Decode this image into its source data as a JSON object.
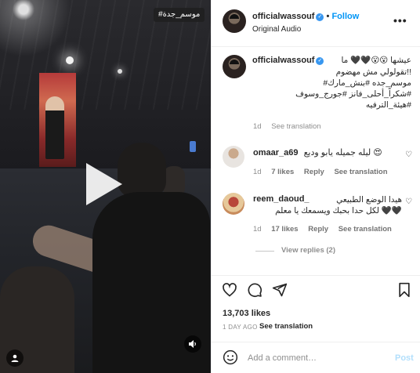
{
  "video": {
    "tag": "#موسم_جدة"
  },
  "header": {
    "username": "officialwassouf",
    "verified_glyph": "✓",
    "separator": "•",
    "follow_label": "Follow",
    "audio": "Original Audio",
    "more_glyph": "•••"
  },
  "caption": {
    "username": "officialwassouf",
    "lines": [
      "عيشها 😮😮🖤🖤 ما",
      "!!تقولولي مش مهضوم",
      "موسم_جده #بنش_مارك#",
      "#شكراً_أحلى_فانز #جورج_وسوف",
      "#هيئة_الترفيه"
    ],
    "age": "1d",
    "see_translation": "See translation"
  },
  "comments": [
    {
      "username": "omaar_a69",
      "text": "ليله جميله يابو وديع 😍",
      "age": "1d",
      "likes": "7 likes",
      "reply": "Reply",
      "see_translation": "See translation"
    },
    {
      "username": "reem_daoud_",
      "text_line1": "هيدا الوضع الطبيعي",
      "text_line2": "🖤🖤 لكل حدا بحبك ويسمعك يا معلم",
      "age": "1d",
      "likes": "17 likes",
      "reply": "Reply",
      "see_translation": "See translation"
    }
  ],
  "view_replies": "View replies (2)",
  "stats": {
    "likes": "13,703 likes",
    "age": "1 DAY AGO",
    "see_translation": "See translation"
  },
  "add_comment": {
    "placeholder": "Add a comment…",
    "post_label": "Post"
  },
  "icons": {
    "heart": "heart-icon",
    "comment": "comment-icon",
    "share": "share-icon",
    "save": "bookmark-icon",
    "emoji": "smiley-icon",
    "mute": "speaker-icon",
    "tags": "user-tag-icon"
  },
  "colors": {
    "accent": "#0095f6",
    "verified": "#3897f0",
    "muted": "#8e8e8e",
    "post_disabled": "#b2dffc"
  }
}
